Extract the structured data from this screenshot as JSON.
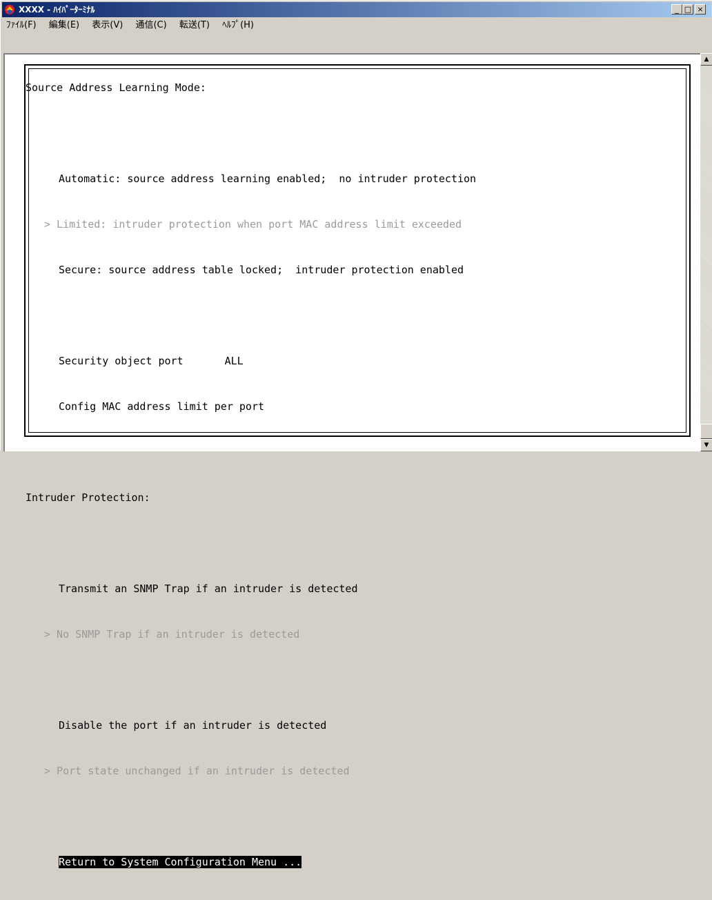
{
  "window": {
    "title": "XXXX - ﾊｲﾊﾟｰﾀｰﾐﾅﾙ",
    "controls": {
      "minimize": "_",
      "maximize": "□",
      "close": "×"
    }
  },
  "menu": [
    "ﾌｧｲﾙ(F)",
    "編集(E)",
    "表示(V)",
    "通信(C)",
    "転送(T)",
    "ﾍﾙﾌﾟ(H)"
  ],
  "terminal": {
    "heading_source": "Source Address Learning Mode:",
    "opt_automatic": "Automatic: source address learning enabled;  no intruder protection",
    "opt_limited": "> Limited: intruder protection when port MAC address limit exceeded",
    "opt_secure": "Secure: source address table locked;  intruder protection enabled",
    "security_port_label": "Security object port",
    "security_port_value": "ALL",
    "config_mac": "Config MAC address limit per port",
    "heading_intruder": "Intruder Protection:",
    "opt_transmit_trap": "Transmit an SNMP Trap if an intruder is detected",
    "opt_no_trap": "> No SNMP Trap if an intruder is detected",
    "opt_disable_port": "Disable the port if an intruder is detected",
    "opt_port_unchanged": "> Port state unchanged if an intruder is detected",
    "return_menu": "Return to System Configuration Menu ..."
  },
  "scrollbar": {
    "up": "▲",
    "down": "▼"
  }
}
